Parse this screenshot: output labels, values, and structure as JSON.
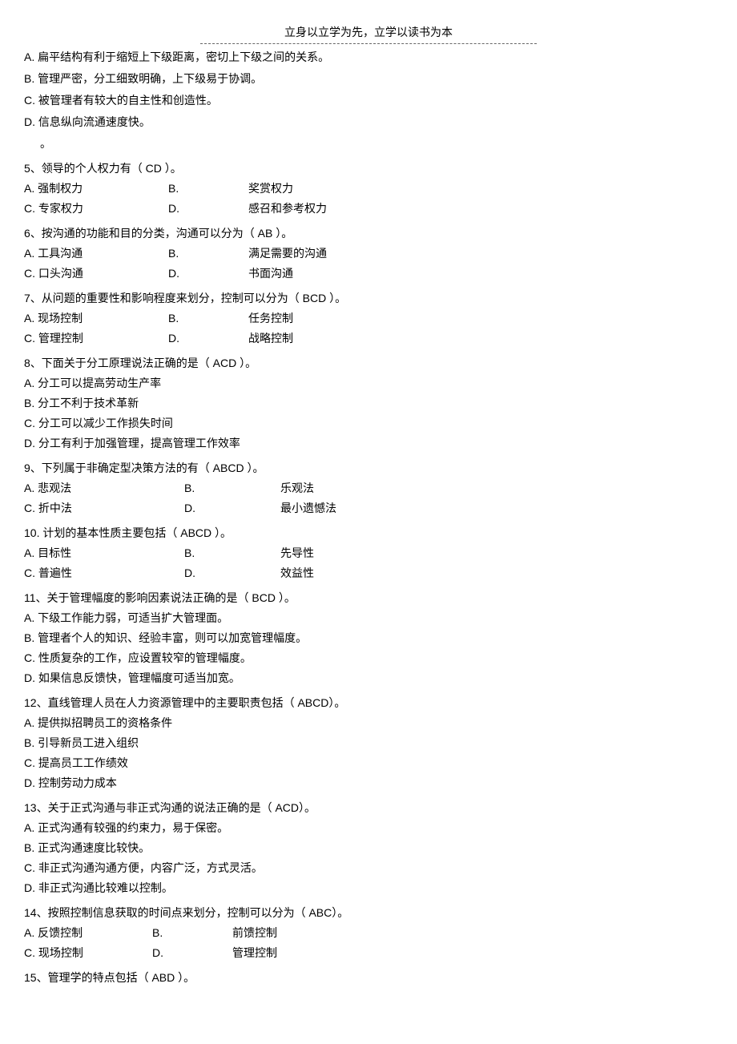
{
  "header": {
    "motto": "立身以立学为先，立学以读书为本"
  },
  "lines": {
    "l1": "A. 扁平结构有利于缩短上下级距离，密切上下级之间的关系。",
    "l2": "B. 管理严密，分工细致明确，上下级易于协调。",
    "l3": "C. 被管理者有较大的自主性和创造性。",
    "l4": "D. 信息纵向流通速度快。",
    "ldot": "。"
  },
  "q5": {
    "stem": "5、领导的个人权力有（    CD  ）。",
    "a": "A. 强制权力",
    "bl": "B.",
    "b": "奖赏权力",
    "c": "C. 专家权力",
    "dl": "D.",
    "d": "感召和参考权力"
  },
  "q6": {
    "stem": "6、按沟通的功能和目的分类，沟通可以分为（    AB  ）。",
    "a": "A. 工具沟通",
    "bl": "B.",
    "b": "满足需要的沟通",
    "c": "C. 口头沟通",
    "dl": "D.",
    "d": "书面沟通"
  },
  "q7": {
    "stem": "7、从问题的重要性和影响程度来划分，控制可以分为（    BCD ）。",
    "a": "A.   现场控制",
    "bl": "B.",
    "b": "任务控制",
    "c": "C.   管理控制",
    "dl": "D.",
    "d": "战略控制"
  },
  "q8": {
    "stem": "8、下面关于分工原理说法正确的是（    ACD ）。",
    "a": "A. 分工可以提高劳动生产率",
    "b": "B. 分工不利于技术革新",
    "c": "C. 分工可以减少工作损失时间",
    "d": "D. 分工有利于加强管理，提高管理工作效率"
  },
  "q9": {
    "stem": "9、下列属于非确定型决策方法的有（    ABCD ）。",
    "a": "A. 悲观法",
    "bl": "B.",
    "b": "乐观法",
    "c": "C. 折中法",
    "dl": "D.",
    "d": "最小遗憾法"
  },
  "q10": {
    "stem": "10. 计划的基本性质主要包括（    ABCD ）。",
    "a": "A. 目标性",
    "bl": "B.",
    "b": "先导性",
    "c": "C. 普遍性",
    "dl": "D.",
    "d": "效益性"
  },
  "q11": {
    "stem": "11、关于管理幅度的影响因素说法正确的是（    BCD ）。",
    "a": "A.   下级工作能力弱，可适当扩大管理面。",
    "b": "B.   管理者个人的知识、经验丰富，则可以加宽管理幅度。",
    "c": "C.   性质复杂的工作，应设置较窄的管理幅度。",
    "d": "D.   如果信息反馈快，管理幅度可适当加宽。"
  },
  "q12": {
    "stem": "12、直线管理人员在人力资源管理中的主要职责包括（    ABCD）。",
    "a": "A. 提供拟招聘员工的资格条件",
    "b": "B. 引导新员工进入组织",
    "c": "C. 提高员工工作绩效",
    "d": "D. 控制劳动力成本"
  },
  "q13": {
    "stem": "13、关于正式沟通与非正式沟通的说法正确的是（    ACD）。",
    "a": "A. 正式沟通有较强的约束力，易于保密。",
    "b": "B. 正式沟通速度比较快。",
    "c": "C. 非正式沟通沟通方便，内容广泛，方式灵活。",
    "d": "D. 非正式沟通比较难以控制。"
  },
  "q14": {
    "stem": "14、按照控制信息获取的时间点来划分，控制可以分为（    ABC）。",
    "a": "A. 反馈控制",
    "bl": "B.",
    "b": "前馈控制",
    "c": "C. 现场控制",
    "dl": "D.",
    "d": "管理控制"
  },
  "q15": {
    "stem": "15、管理学的特点包括（    ABD ）。"
  }
}
